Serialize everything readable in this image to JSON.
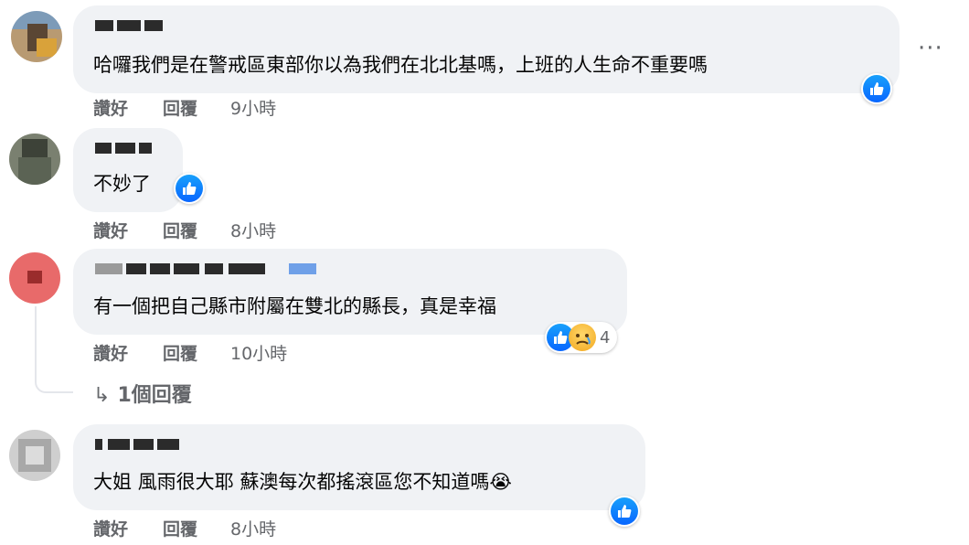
{
  "comments": [
    {
      "text": "哈囉我們是在警戒區東部你以為我們在北北基嗎，上班的人生命不重要嗎",
      "actions": {
        "like": "讚好",
        "reply": "回覆",
        "time": "9小時"
      }
    },
    {
      "text": "不妙了",
      "actions": {
        "like": "讚好",
        "reply": "回覆",
        "time": "8小時"
      }
    },
    {
      "text": "有一個把自己縣市附屬在雙北的縣長，真是幸福",
      "actions": {
        "like": "讚好",
        "reply": "回覆",
        "time": "10小時"
      },
      "reaction_count": "4",
      "replies_link": "1個回覆"
    },
    {
      "text": "大姐 風雨很大耶 蘇澳每次都搖滾區您不知道嗎😭",
      "actions": {
        "like": "讚好",
        "reply": "回覆",
        "time": "8小時"
      }
    }
  ],
  "more_button": "···",
  "reply_arrow": "↳"
}
